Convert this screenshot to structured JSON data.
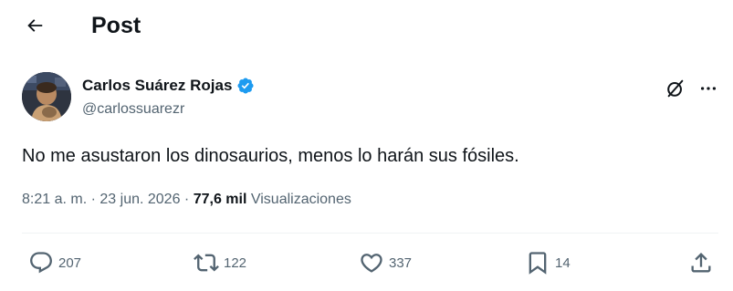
{
  "header": {
    "title": "Post",
    "back_icon": "arrow-left-icon"
  },
  "author": {
    "name": "Carlos Suárez Rojas",
    "handle": "@carlossuarezr",
    "verified_color": "#1d9bf0"
  },
  "post": {
    "text": "No me asustaron los dinosaurios, menos lo harán sus fósiles.",
    "time": "8:21 a. m.",
    "separator": "·",
    "date": "23 jun. 2026",
    "views_count": "77,6 mil",
    "views_label": "Visualizaciones"
  },
  "actions": {
    "replies": "207",
    "reposts": "122",
    "likes": "337",
    "bookmarks": "14"
  },
  "colors": {
    "text": "#0f1419",
    "secondary": "#536471",
    "divider": "#eff3f4",
    "accent": "#1d9bf0"
  }
}
